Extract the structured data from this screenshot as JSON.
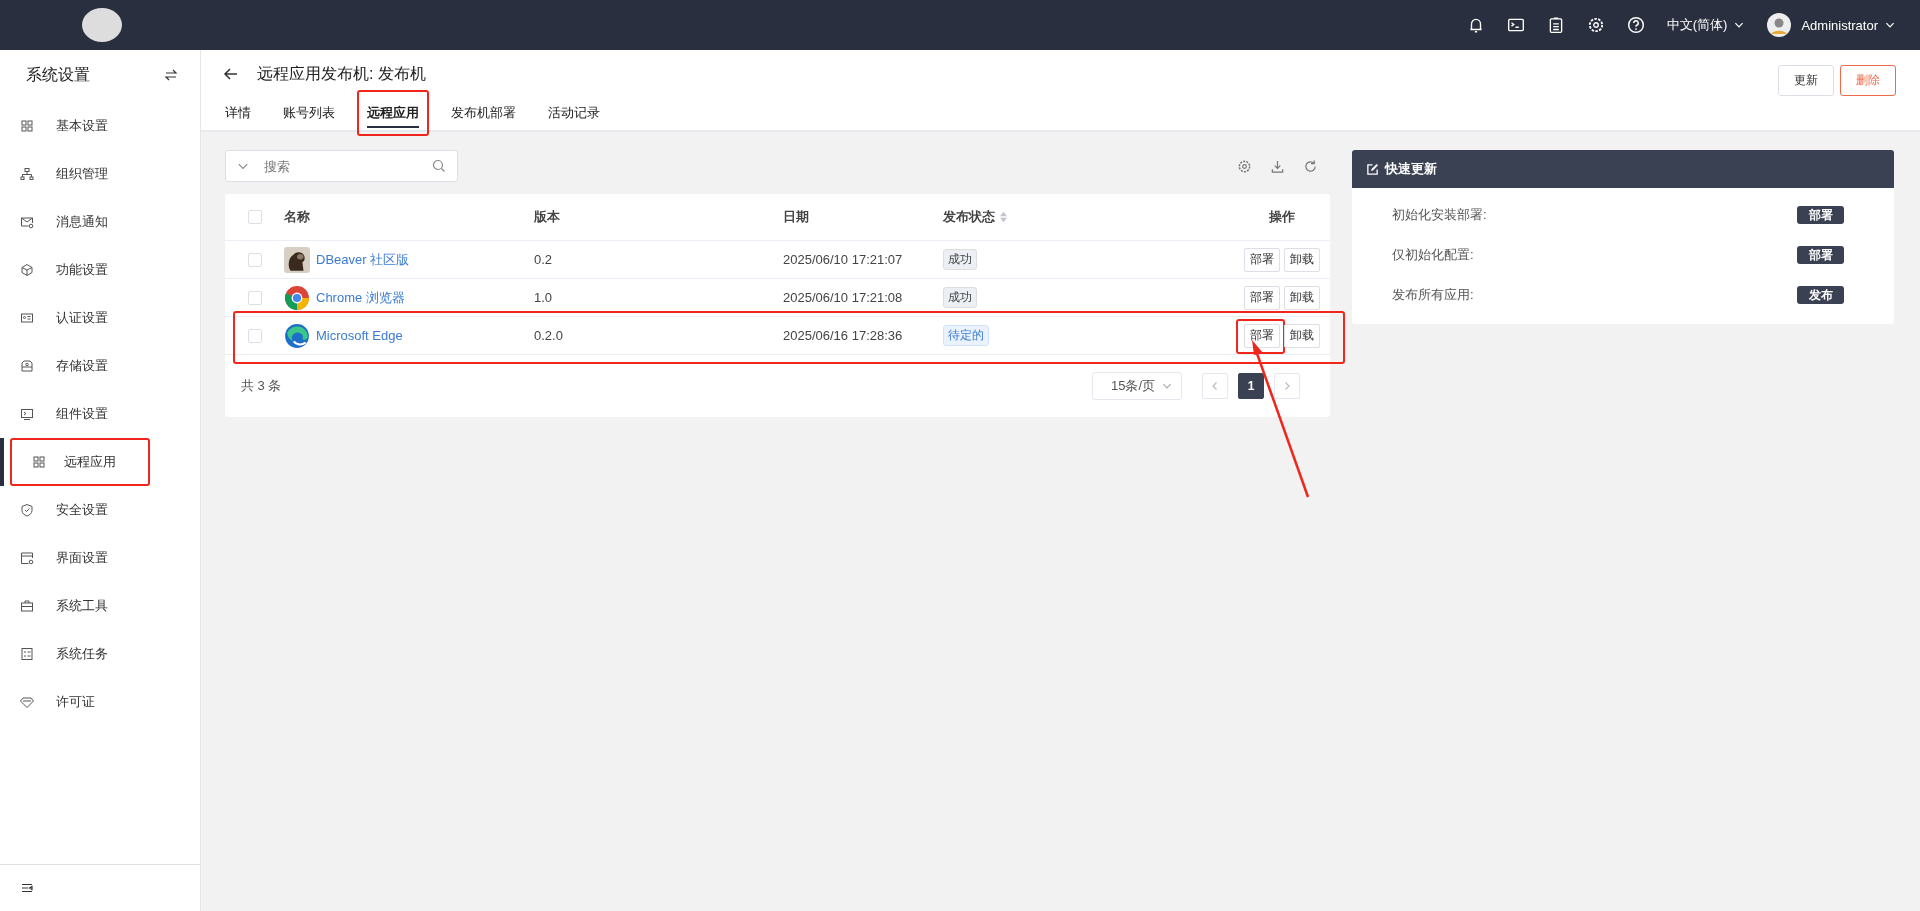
{
  "topbar": {
    "language": "中文(简体)",
    "user": "Administrator"
  },
  "sidebar": {
    "title": "系统设置",
    "items": [
      {
        "label": "基本设置",
        "selected": false,
        "highlighted": false
      },
      {
        "label": "组织管理",
        "selected": false,
        "highlighted": false
      },
      {
        "label": "消息通知",
        "selected": false,
        "highlighted": false
      },
      {
        "label": "功能设置",
        "selected": false,
        "highlighted": false
      },
      {
        "label": "认证设置",
        "selected": false,
        "highlighted": false
      },
      {
        "label": "存储设置",
        "selected": false,
        "highlighted": false
      },
      {
        "label": "组件设置",
        "selected": false,
        "highlighted": false
      },
      {
        "label": "远程应用",
        "selected": true,
        "highlighted": true
      },
      {
        "label": "安全设置",
        "selected": false,
        "highlighted": false
      },
      {
        "label": "界面设置",
        "selected": false,
        "highlighted": false
      },
      {
        "label": "系统工具",
        "selected": false,
        "highlighted": false
      },
      {
        "label": "系统任务",
        "selected": false,
        "highlighted": false
      },
      {
        "label": "许可证",
        "selected": false,
        "highlighted": false
      }
    ]
  },
  "header": {
    "title": "远程应用发布机: 发布机",
    "buttons": [
      {
        "label": "更新",
        "kind": "default"
      },
      {
        "label": "删除",
        "kind": "danger"
      }
    ]
  },
  "tabs": [
    {
      "label": "详情",
      "selected": false,
      "highlighted": false
    },
    {
      "label": "账号列表",
      "selected": false,
      "highlighted": false
    },
    {
      "label": "远程应用",
      "selected": true,
      "highlighted": true
    },
    {
      "label": "发布机部署",
      "selected": false,
      "highlighted": false
    },
    {
      "label": "活动记录",
      "selected": false,
      "highlighted": false
    }
  ],
  "search": {
    "placeholder": "搜索"
  },
  "table": {
    "all_checked": false,
    "columns": [
      "名称",
      "版本",
      "日期",
      "发布状态",
      "操作"
    ],
    "rows": [
      {
        "name": "DBeaver 社区版",
        "version": "0.2",
        "date": "2025/06/10 17:21:07",
        "status": "成功",
        "kind": "success",
        "actions": [
          "部署",
          "卸载"
        ],
        "highlighted": false,
        "checked": false
      },
      {
        "name": "Chrome 浏览器",
        "version": "1.0",
        "date": "2025/06/10 17:21:08",
        "status": "成功",
        "kind": "success",
        "actions": [
          "部署",
          "卸载"
        ],
        "highlighted": false,
        "checked": false
      },
      {
        "name": "Microsoft Edge",
        "version": "0.2.0",
        "date": "2025/06/16 17:28:36",
        "status": "待定的",
        "kind": "pending",
        "actions": [
          "部署",
          "卸载"
        ],
        "highlighted": true,
        "checked": false
      }
    ],
    "total": "共 3 条",
    "page_size": "15条/页",
    "page": "1"
  },
  "quick_update": {
    "title": "快速更新",
    "items": [
      {
        "label": "初始化安装部署:",
        "button": "部署"
      },
      {
        "label": "仅初始化配置:",
        "button": "部署"
      },
      {
        "label": "发布所有应用:",
        "button": "发布"
      }
    ]
  }
}
